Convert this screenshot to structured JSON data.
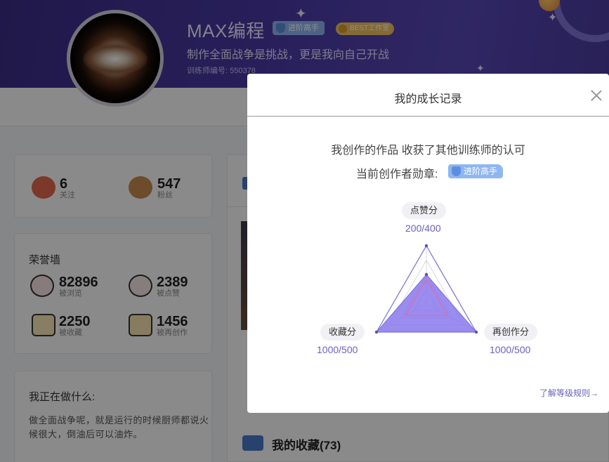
{
  "profile": {
    "name": "MAX编程",
    "badge_level": "进阶高手",
    "badge_best": "BEST工作室",
    "motto": "制作全面战争是挑战，更是我向自己开战",
    "trainer_id": "训练师编号: 550378"
  },
  "follow_stats": [
    {
      "value": "6",
      "label": "关注"
    },
    {
      "value": "547",
      "label": "粉丝"
    }
  ],
  "honor_wall": {
    "title": "荣誉墙",
    "items": [
      {
        "value": "82896",
        "label": "被浏览"
      },
      {
        "value": "2389",
        "label": "被点赞"
      },
      {
        "value": "2250",
        "label": "被收藏"
      },
      {
        "value": "1456",
        "label": "被再创作"
      }
    ]
  },
  "doing": {
    "title": "我正在做什么:",
    "text": "做全面战争呢，就是运行的时候厨师都说火候很大，倒油后可以油炸。"
  },
  "favorites": {
    "title": "我的收藏(73)"
  },
  "modal": {
    "title": "我的成长记录",
    "recognition": "我创作的作品 收获了其他训练师的认可",
    "medal_label": "当前创作者勋章:",
    "medal_name": "进阶高手",
    "rules_link": "了解等级规则→"
  },
  "chart_data": {
    "type": "radar",
    "axes": [
      {
        "name": "点赞分",
        "value": 200,
        "max": 400,
        "label": "200/400"
      },
      {
        "name": "再创作分",
        "value": 1000,
        "max": 500,
        "label": "1000/500"
      },
      {
        "name": "收藏分",
        "value": 1000,
        "max": 500,
        "label": "1000/500"
      }
    ],
    "colors": {
      "fill": "#8a78ec",
      "outline": "#7b70d8",
      "threshold": "#e06aa6",
      "grid": "#d8d8de"
    }
  },
  "colors": {
    "banner": "#4a3aa6",
    "accent": "#6a5fc2",
    "badge_blue": "#8eb6f2",
    "badge_gold": "#f0c25e"
  }
}
